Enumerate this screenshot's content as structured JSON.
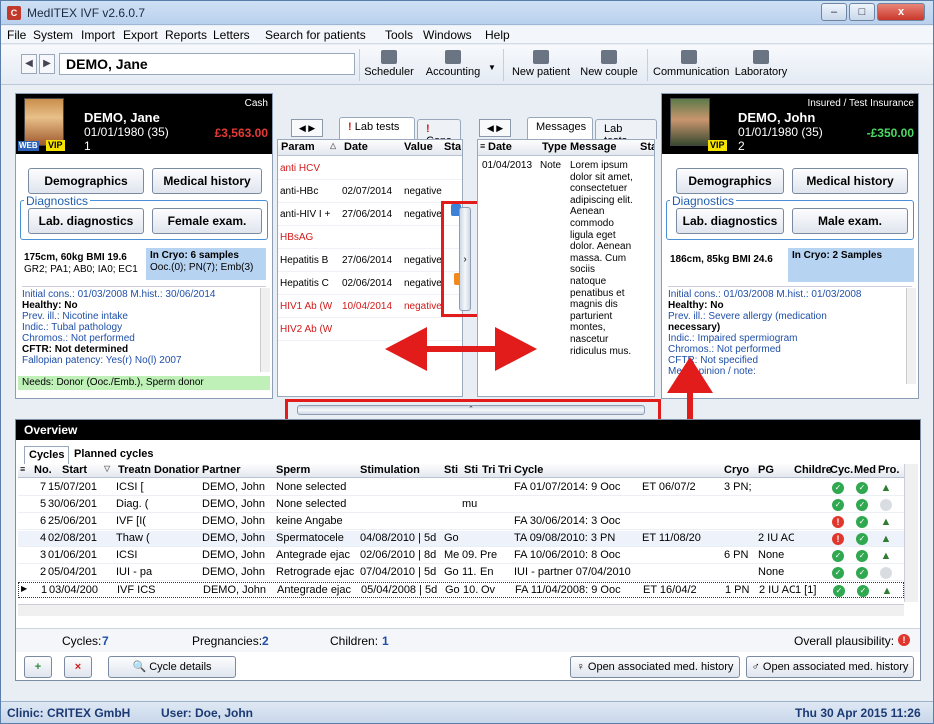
{
  "window": {
    "title": "MedITEX IVF v2.6.0.7",
    "logo": "C",
    "min": "–",
    "max": "□",
    "close": "x"
  },
  "menu": [
    "File",
    "System",
    "Import",
    "Export",
    "Reports",
    "Letters",
    "Search for patients",
    "Tools",
    "Windows",
    "Help"
  ],
  "toolbar": {
    "patient": "DEMO, Jane",
    "buttons": [
      "Scheduler",
      "Accounting",
      "New patient",
      "New couple",
      "Communication",
      "Laboratory"
    ]
  },
  "female": {
    "payer": "Cash",
    "name": "DEMO, Jane",
    "dob": "01/01/1980  (35)",
    "balance": "£3,563.00",
    "number": "1",
    "web": "WEB",
    "vip": "VIP",
    "btn_demographics": "Demographics",
    "btn_history": "Medical history",
    "diag_label": "Diagnostics",
    "btn_lab": "Lab. diagnostics",
    "btn_exam": "Female exam.",
    "vitals1": "175cm, 60kg BMI 19.6",
    "vitals2": "GR2; PA1; AB0; IA0; EC1",
    "cryo1": "In Cryo: 6 samples",
    "cryo2": "Ooc.(0); PN(7); Emb(3)",
    "info": [
      "Initial cons.: 01/03/2008  M.hist.: 30/06/2014",
      "Healthy: No",
      "Prev. ill.: Nicotine intake",
      "Indic.: Tubal pathology",
      "Chromos.: Not performed",
      "CFTR: Not determined",
      "Fallopian patency: Yes(r) No(l) 2007"
    ],
    "needs": "Needs: Donor (Ooc./Emb.), Sperm donor"
  },
  "male": {
    "payer": "Insured / Test Insurance",
    "name": "DEMO, John",
    "dob": "01/01/1980  (35)",
    "balance": "-£350.00",
    "number": "2",
    "vip": "VIP",
    "btn_demographics": "Demographics",
    "btn_history": "Medical history",
    "diag_label": "Diagnostics",
    "btn_lab": "Lab. diagnostics",
    "btn_exam": "Male exam.",
    "vitals1": "186cm, 85kg BMI 24.6",
    "cryo1": "In Cryo: 2 Samples",
    "info": [
      "Initial cons.: 01/03/2008  M.hist.: 01/03/2008",
      "Healthy: No",
      "Prev. ill.: Severe allergy (medication",
      "necessary)",
      "Indic.: Impaired spermiogram",
      "Chromos.: Not performed",
      "CFTR: Not specified",
      "Med. opinion / note:"
    ]
  },
  "labpanel": {
    "tabs": [
      "Lab tests",
      "Cons"
    ],
    "cols": [
      "Param",
      "Date",
      "Value",
      "Sta"
    ],
    "rows": [
      {
        "param": "anti HCV",
        "date": "",
        "value": "",
        "red": true
      },
      {
        "param": "anti-HBc",
        "date": "02/07/2014",
        "value": "negative",
        "red": false
      },
      {
        "param": "anti-HIV I +",
        "date": "27/06/2014",
        "value": "negative",
        "red": false
      },
      {
        "param": "HBsAG",
        "date": "",
        "value": "",
        "red": true
      },
      {
        "param": "Hepatitis B",
        "date": "27/06/2014",
        "value": "negative",
        "red": false
      },
      {
        "param": "Hepatitis C",
        "date": "02/06/2014",
        "value": "negative",
        "red": false
      },
      {
        "param": "HIV1 Ab (W",
        "date": "10/04/2014",
        "value": "negative",
        "red": true
      },
      {
        "param": "HIV2 Ab (W",
        "date": "",
        "value": "",
        "red": true
      }
    ]
  },
  "msgpanel": {
    "tabs": [
      "Messages",
      "Lab tests"
    ],
    "cols": [
      "Date",
      "Type",
      "Message",
      "Sta"
    ],
    "date": "01/04/2013",
    "type": "Note",
    "message": [
      "Lorem ipsum",
      "dolor sit amet,",
      "consectetuer",
      "adipiscing elit.",
      "Aenean",
      "commodo",
      "ligula eget",
      "dolor. Aenean",
      "massa. Cum",
      "sociis",
      "natoque",
      "penatibus et",
      "magnis dis",
      "parturient",
      "montes,",
      "nascetur",
      "ridiculus mus."
    ]
  },
  "overview": {
    "title": "Overview",
    "tabs": [
      "Cycles",
      "Planned cycles"
    ],
    "cols": [
      "No.",
      "Start",
      "Treatn",
      "Donatior",
      "Partner",
      "Sperm",
      "Stimulation",
      "Sti",
      "Sti",
      "Tri",
      "Tri",
      "Cycle",
      "",
      "Cryo",
      "PG",
      "Childre",
      "Cyc.",
      "Med",
      "Pro."
    ],
    "rows": [
      {
        "no": "7",
        "start": "15/07/201",
        "treat": "ICSI  [",
        "partner": "DEMO, John",
        "sperm": "None selected",
        "stim": "",
        "s1": "",
        "s2": "",
        "t1": "",
        "cycle": "FA 01/07/2014: 9 Ooc",
        "et": "ET 06/07/2",
        "cryo": "3 PN;",
        "pg": "",
        "cyc": "ok",
        "med": "ok",
        "pro": "thumb"
      },
      {
        "no": "5",
        "start": "30/06/201",
        "treat": "Diag. (",
        "partner": "DEMO, John",
        "sperm": "None selected",
        "stim": "",
        "s1": "",
        "s2": "mu",
        "t1": "",
        "cycle": "",
        "et": "",
        "cryo": "",
        "pg": "",
        "cyc": "ok",
        "med": "ok",
        "pro": "gray"
      },
      {
        "no": "6",
        "start": "25/06/201",
        "treat": "IVF  [I(",
        "partner": "DEMO, John",
        "sperm": "keine Angabe",
        "stim": "",
        "s1": "",
        "s2": "",
        "t1": "",
        "cycle": "FA 30/06/2014: 3 Ooc",
        "et": "",
        "cryo": "",
        "pg": "",
        "cyc": "err",
        "med": "ok",
        "pro": "thumb"
      },
      {
        "no": "4",
        "start": "02/08/201",
        "treat": "Thaw (",
        "partner": "DEMO, John",
        "sperm": "Spermatocele",
        "stim": "04/08/2010 | 5d",
        "s1": "Go",
        "s2": "",
        "t1": "",
        "cycle": "TA 09/08/2010: 3 PN",
        "et": "ET 11/08/20",
        "cryo": "",
        "pg": "2 IU AC",
        "cyc": "err",
        "med": "ok",
        "pro": "thumb"
      },
      {
        "no": "3",
        "start": "01/06/201",
        "treat": "ICSI",
        "partner": "DEMO, John",
        "sperm": "Antegrade ejac",
        "stim": "02/06/2010 | 8d",
        "s1": "Me",
        "s2": "09.",
        "t1": "Pre",
        "cycle": "FA 10/06/2010: 8 Ooc",
        "et": "",
        "cryo": "6 PN",
        "pg": "None",
        "cyc": "ok",
        "med": "ok",
        "pro": "thumb"
      },
      {
        "no": "2",
        "start": "05/04/201",
        "treat": "IUI - pa",
        "partner": "DEMO, John",
        "sperm": "Retrograde ejac",
        "stim": "07/04/2010 | 5d",
        "s1": "Go",
        "s2": "11.",
        "t1": "En",
        "cycle": "IUI - partner 07/04/2010",
        "et": "",
        "cryo": "",
        "pg": "None",
        "cyc": "ok",
        "med": "ok",
        "pro": "gray"
      },
      {
        "no": "1",
        "start": "03/04/200",
        "treat": "IVF ICS",
        "partner": "DEMO, John",
        "sperm": "Antegrade ejac",
        "stim": "05/04/2008 | 5d",
        "s1": "Go",
        "s2": "10.",
        "t1": "Ov",
        "cycle": "FA 11/04/2008: 9 Ooc",
        "et": "ET 16/04/2",
        "cryo": "1 PN",
        "pg": "2 IU AC",
        "child": "1 [1]",
        "cyc": "ok",
        "med": "ok",
        "pro": "thumb"
      }
    ],
    "summary": {
      "cycles_label": "Cycles:",
      "cycles": "7",
      "preg_label": "Pregnancies:",
      "preg": "2",
      "child_label": "Children:",
      "child": "1",
      "plaus": "Overall plausibility:"
    },
    "btn_cycle": "Cycle details",
    "btn_med_f": "Open associated med. history",
    "btn_med_m": "Open associated med. history"
  },
  "status": {
    "clinic": "Clinic: CRITEX GmbH",
    "user": "User: Doe, John",
    "date": "Thu 30 Apr 2015 11:26"
  },
  "colors": {
    "accent_red": "#e21b1b",
    "balance_female": "#e53935",
    "balance_male": "#4cd964"
  }
}
